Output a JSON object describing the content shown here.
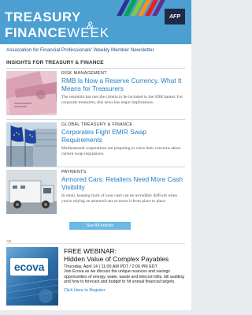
{
  "header": {
    "brand_line1": "TREASURY",
    "brand_amp": "&",
    "brand_line2_bold": "FINANCE",
    "brand_line2_light": "WEEK",
    "badge": "AFP",
    "stripe_colors": [
      "#2e3192",
      "#00a651",
      "#8dc63f",
      "#f7941d",
      "#ed1c24",
      "#662d91"
    ]
  },
  "tagline": "Association for Financial Professionals' Weekly Member Newsletter",
  "section_title": "INSIGHTS FOR TREASURY & FINANCE",
  "articles": [
    {
      "category": "RISK MANAGEMENT",
      "headline": "RMB Is Now a Reserve Currency. What It Means for Treasurers",
      "summary": "The renminbi has met the criteria to be included in the SDR basket. For corporate treasurers, this news has major implications.",
      "image_icon": "currency-notes-image"
    },
    {
      "category": "GLOBAL TREASURY & FINANCE",
      "headline": "Corporates Fight EMIR Swap Requirements",
      "summary": "Multinational corporations are preparing to voice their concerns about current swap regulations.",
      "image_icon": "eu-flags-image"
    },
    {
      "category": "PAYMENTS",
      "headline": "Armored Cars: Retailers Need More Cash Visibility",
      "summary": "In retail, keeping track of your cash can be incredibly difficult when you're relying on armored cars to move it from place to place.",
      "image_icon": "armored-truck-image"
    }
  ],
  "see_all": "See All Articles",
  "ad": {
    "label": "AD",
    "logo": "ecova",
    "title1": "FREE WEBINAR:",
    "title2": "Hidden Value of Complex Payables",
    "when": "Thursday, April 14  |  11:00 AM PDT / 2:00 PM EDT",
    "description": "Join Ecova as we discuss the unique nuances and savings opportunities of energy, water, waste and telecom bills, bill auditing and how to forecast and budget to hit annual financial targets.",
    "link": "Click Here to Register"
  },
  "colors": {
    "banner": "#4b9fd1",
    "headline": "#1e7dc4",
    "button": "#6cb8e6"
  }
}
